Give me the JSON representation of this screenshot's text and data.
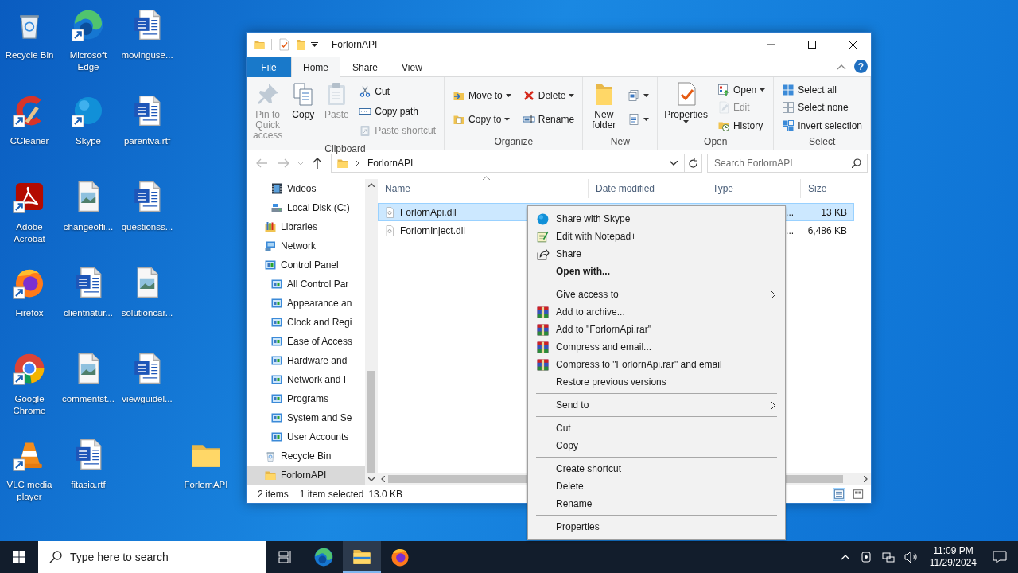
{
  "desktop_icons": [
    {
      "label": "Recycle Bin",
      "kind": "recycle",
      "shortcut": false
    },
    {
      "label": "CCleaner",
      "kind": "ccleaner",
      "shortcut": true
    },
    {
      "label": "Adobe Acrobat",
      "kind": "acrobat",
      "shortcut": true
    },
    {
      "label": "Firefox",
      "kind": "firefox",
      "shortcut": true
    },
    {
      "label": "Google Chrome",
      "kind": "chrome",
      "shortcut": true
    },
    {
      "label": "VLC media player",
      "kind": "vlc",
      "shortcut": true
    },
    {
      "label": "Microsoft Edge",
      "kind": "edge",
      "shortcut": true
    },
    {
      "label": "Skype",
      "kind": "skype",
      "shortcut": true
    },
    {
      "label": "changeoffi...",
      "kind": "image",
      "shortcut": false
    },
    {
      "label": "clientnatur...",
      "kind": "word",
      "shortcut": false
    },
    {
      "label": "commentst...",
      "kind": "image",
      "shortcut": false
    },
    {
      "label": "fitasia.rtf",
      "kind": "word",
      "shortcut": false
    },
    {
      "label": "movinguse...",
      "kind": "word",
      "shortcut": false
    },
    {
      "label": "parentva.rtf",
      "kind": "word",
      "shortcut": false
    },
    {
      "label": "questionss...",
      "kind": "word",
      "shortcut": false
    },
    {
      "label": "solutioncar...",
      "kind": "image",
      "shortcut": false
    },
    {
      "label": "viewguidel...",
      "kind": "word",
      "shortcut": false
    },
    {
      "label": "ForlornAPI",
      "kind": "folder",
      "shortcut": false
    }
  ],
  "explorer": {
    "title": "ForlornAPI",
    "help": "?",
    "tabs": [
      {
        "label": "File",
        "kind": "file",
        "selected": false
      },
      {
        "label": "Home",
        "kind": "tab",
        "selected": true
      },
      {
        "label": "Share",
        "kind": "tab",
        "selected": false
      },
      {
        "label": "View",
        "kind": "tab",
        "selected": false
      }
    ],
    "ribbon": [
      {
        "label": "Clipboard",
        "columns": [
          [
            {
              "label": "Pin to Quick access",
              "kind": "pin",
              "disabled": true,
              "menu": false
            }
          ],
          [
            {
              "label": "Copy",
              "kind": "copy",
              "disabled": false,
              "menu": false
            }
          ],
          [
            {
              "label": "Paste",
              "kind": "paste",
              "disabled": true,
              "menu": false
            }
          ],
          [
            {
              "label": "Cut",
              "kind": "cut",
              "disabled": false,
              "menu": false
            },
            {
              "label": "Copy path",
              "kind": "copypath",
              "disabled": false,
              "menu": false
            },
            {
              "label": "Paste shortcut",
              "kind": "pasteshortcut",
              "disabled": true,
              "menu": false
            }
          ]
        ]
      },
      {
        "label": "Organize",
        "columns": [
          [
            {
              "label": "Move to",
              "kind": "moveto",
              "disabled": false,
              "menu": true
            },
            {
              "label": "Copy to",
              "kind": "copyto",
              "disabled": false,
              "menu": true
            }
          ],
          [
            {
              "label": "Delete",
              "kind": "delete",
              "disabled": false,
              "menu": true
            },
            {
              "label": "Rename",
              "kind": "rename",
              "disabled": false,
              "menu": false
            }
          ]
        ]
      },
      {
        "label": "New",
        "columns": [
          [
            {
              "label": "New folder",
              "kind": "newfolder",
              "disabled": false,
              "menu": false
            }
          ],
          [
            {
              "kind": "newitem",
              "disabled": false,
              "menu": true
            },
            {
              "kind": "easyaccess",
              "disabled": false,
              "menu": true
            }
          ]
        ]
      },
      {
        "label": "Open",
        "columns": [
          [
            {
              "label": "Properties",
              "kind": "properties",
              "disabled": false,
              "menu": true
            }
          ],
          [
            {
              "label": "Open",
              "kind": "open",
              "disabled": false,
              "menu": true
            },
            {
              "label": "Edit",
              "kind": "edit",
              "disabled": true,
              "menu": false
            },
            {
              "label": "History",
              "kind": "history",
              "disabled": false,
              "menu": false
            }
          ]
        ]
      },
      {
        "label": "Select",
        "columns": [
          [
            {
              "label": "Select all",
              "kind": "selectall",
              "disabled": false,
              "menu": false
            },
            {
              "label": "Select none",
              "kind": "selectnone",
              "disabled": false,
              "menu": false
            },
            {
              "label": "Invert selection",
              "kind": "invert",
              "disabled": false,
              "menu": false
            }
          ]
        ]
      }
    ],
    "address": {
      "path": [
        "ForlornAPI"
      ]
    },
    "search": {
      "placeholder": "Search ForlornAPI"
    },
    "nav_pane": [
      {
        "children": [
          {
            "label": "Videos",
            "kind": "videos",
            "selected": false
          },
          {
            "label": "Local Disk (C:)",
            "kind": "disk",
            "selected": false
          }
        ]
      },
      {
        "label": "Libraries",
        "kind": "libraries",
        "selected": false
      },
      {
        "label": "Network",
        "kind": "network",
        "selected": false
      },
      {
        "label": "Control Panel",
        "kind": "cpl",
        "selected": false,
        "children": [
          {
            "label": "All Control Par",
            "kind": "cpl",
            "selected": false
          },
          {
            "label": "Appearance an",
            "kind": "cpl",
            "selected": false
          },
          {
            "label": "Clock and Regi",
            "kind": "cpl",
            "selected": false
          },
          {
            "label": "Ease of Access",
            "kind": "cpl",
            "selected": false
          },
          {
            "label": "Hardware and",
            "kind": "cpl",
            "selected": false
          },
          {
            "label": "Network and I",
            "kind": "cpl",
            "selected": false
          },
          {
            "label": "Programs",
            "kind": "cpl",
            "selected": false
          },
          {
            "label": "System and Se",
            "kind": "cpl",
            "selected": false
          },
          {
            "label": "User Accounts",
            "kind": "cpl",
            "selected": false
          }
        ]
      },
      {
        "label": "Recycle Bin",
        "kind": "recycle",
        "selected": false
      },
      {
        "label": "ForlornAPI",
        "kind": "folder",
        "selected": true
      }
    ],
    "columns": [
      {
        "label": "Name",
        "sorted": true
      },
      {
        "label": "Date modified",
        "sorted": false
      },
      {
        "label": "Type",
        "sorted": false
      },
      {
        "label": "Size",
        "sorted": false
      }
    ],
    "files": [
      {
        "name": "ForlornApi.dll",
        "type": "...",
        "size": "13 KB",
        "selected": true
      },
      {
        "name": "ForlornInject.dll",
        "type": "...",
        "size": "6,486 KB",
        "selected": false
      }
    ],
    "status": {
      "items": "2 items",
      "selection": "1 item selected",
      "size": "13.0 KB"
    },
    "views": [
      {
        "kind": "details",
        "selected": true
      },
      {
        "kind": "tiles",
        "selected": false
      }
    ]
  },
  "context_menu": [
    {
      "label": "Share with Skype",
      "kind": "skype",
      "default": false
    },
    {
      "label": "Edit with Notepad++",
      "kind": "notepad",
      "default": false
    },
    {
      "label": "Share",
      "kind": "share",
      "default": false
    },
    {
      "label": "Open with...",
      "kind": "plain",
      "default": true
    },
    {
      "kind": "separator"
    },
    {
      "label": "Give access to",
      "kind": "submenu",
      "default": false
    },
    {
      "label": "Add to archive...",
      "kind": "archive",
      "default": false
    },
    {
      "label": "Add to \"ForlornApi.rar\"",
      "kind": "archive",
      "default": false
    },
    {
      "label": "Compress and email...",
      "kind": "archive",
      "default": false
    },
    {
      "label": "Compress to \"ForlornApi.rar\" and email",
      "kind": "archive",
      "default": false
    },
    {
      "label": "Restore previous versions",
      "kind": "plain",
      "default": false
    },
    {
      "kind": "separator"
    },
    {
      "label": "Send to",
      "kind": "submenu",
      "default": false
    },
    {
      "kind": "separator"
    },
    {
      "label": "Cut",
      "kind": "plain",
      "default": false
    },
    {
      "label": "Copy",
      "kind": "plain",
      "default": false
    },
    {
      "kind": "separator"
    },
    {
      "label": "Create shortcut",
      "kind": "plain",
      "default": false
    },
    {
      "label": "Delete",
      "kind": "plain",
      "default": false
    },
    {
      "label": "Rename",
      "kind": "plain",
      "default": false
    },
    {
      "kind": "separator"
    },
    {
      "label": "Properties",
      "kind": "plain",
      "default": false
    }
  ],
  "taskbar": {
    "search_placeholder": "Type here to search",
    "apps": [
      {
        "kind": "edge",
        "active": false
      },
      {
        "kind": "explorer",
        "active": true
      },
      {
        "kind": "firefox",
        "active": false
      }
    ],
    "time": "11:09 PM",
    "date": "11/29/2024"
  }
}
